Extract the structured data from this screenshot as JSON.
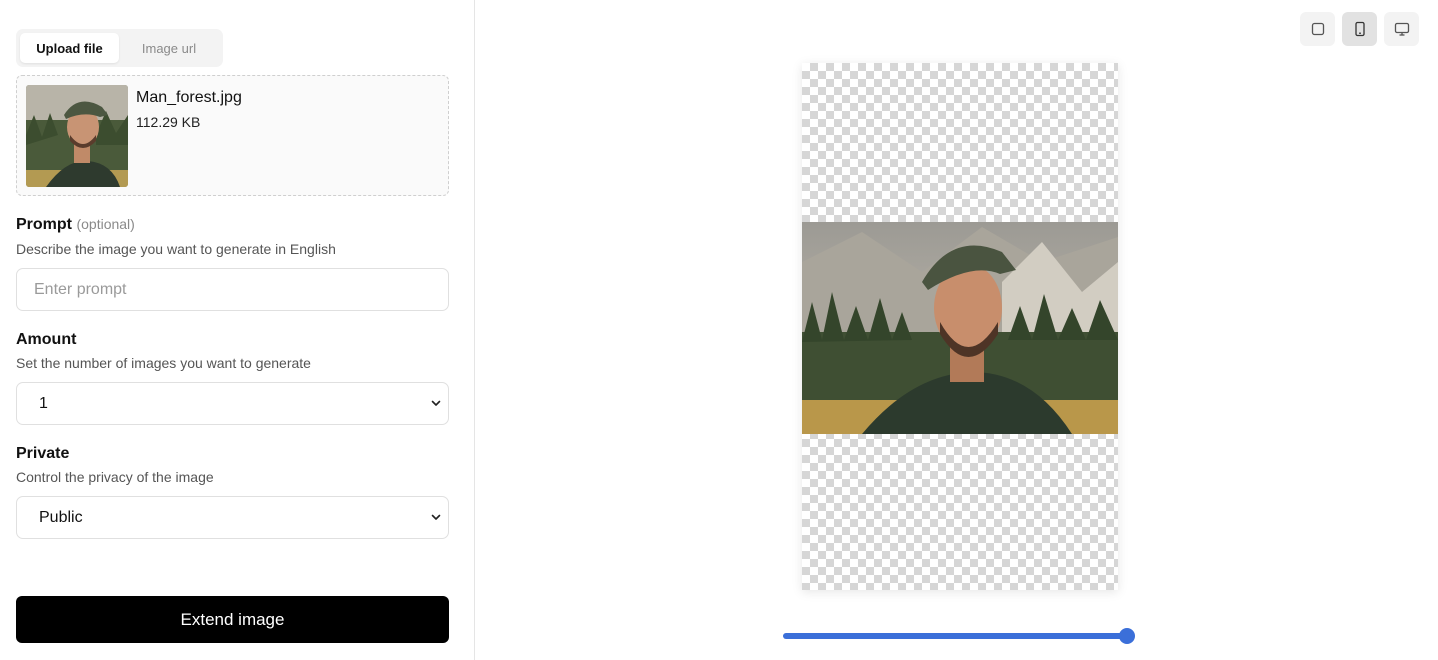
{
  "tabs": [
    {
      "label": "Upload file",
      "active": true
    },
    {
      "label": "Image url",
      "active": false
    }
  ],
  "file": {
    "name": "Man_forest.jpg",
    "size": "112.29 KB",
    "thumbnail": "man-forest-photo"
  },
  "prompt": {
    "label": "Prompt",
    "optional": "(optional)",
    "help": "Describe the image you want to generate in English",
    "value": "",
    "placeholder": "Enter prompt"
  },
  "amount": {
    "label": "Amount",
    "help": "Set the number of images you want to generate",
    "value": "1"
  },
  "private": {
    "label": "Private",
    "help": "Control the privacy of the image",
    "value": "Public"
  },
  "extend_button": {
    "label": "Extend image"
  },
  "view_modes": [
    {
      "icon": "square-icon",
      "active": false
    },
    {
      "icon": "phone-icon",
      "active": true
    },
    {
      "icon": "monitor-icon",
      "active": false
    }
  ],
  "slider": {
    "value_fraction": 1.0,
    "color": "#3b6fd9"
  },
  "colors": {
    "accent": "#3b6fd9",
    "button_bg": "#000000",
    "button_text": "#ffffff"
  }
}
